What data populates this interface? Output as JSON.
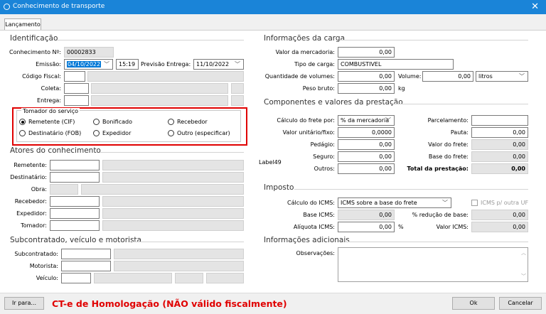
{
  "window": {
    "title": "Conhecimento de transporte",
    "close": "✕"
  },
  "tabs": [
    "Lançamento"
  ],
  "identificacao": {
    "title": "Identificação",
    "numero_label": "Conhecimento Nº:",
    "numero": "00002833",
    "emissao_label": "Emissão:",
    "emissao_date": "04/10/2022",
    "emissao_time": "15:19",
    "previsao_label": "Previsão Entrega:",
    "previsao_date": "11/10/2022",
    "codigo_fiscal_label": "Código Fiscal:",
    "coleta_label": "Coleta:",
    "entrega_label": "Entrega:"
  },
  "tomador": {
    "title": "Tomador do serviço",
    "options": [
      "Remetente (CIF)",
      "Bonificado",
      "Recebedor",
      "Destinatário (FOB)",
      "Expedidor",
      "Outro (especificar)"
    ]
  },
  "atores": {
    "title": "Atores do conhecimento",
    "remetente": "Remetente:",
    "destinatario": "Destinatário:",
    "obra": "Obra:",
    "recebedor": "Recebedor:",
    "expedidor": "Expedidor:",
    "tomador": "Tomador:"
  },
  "subcontratado": {
    "title": "Subcontratado, veículo e motorista",
    "subcontratado": "Subcontratado:",
    "motorista": "Motorista:",
    "veiculo": "Veículo:"
  },
  "carga": {
    "title": "Informações da carga",
    "valor_label": "Valor da mercadoria:",
    "valor": "0,00",
    "tipo_label": "Tipo de carga:",
    "tipo": "COMBUSTIVEL",
    "qtd_label": "Quantidade de volumes:",
    "qtd": "0,00",
    "volume_label": "Volume:",
    "volume": "0,00",
    "unidade": "litros",
    "peso_label": "Peso bruto:",
    "peso": "0,00",
    "peso_unit": "kg"
  },
  "componentes": {
    "title": "Componentes e valores da prestação",
    "calculo_label": "Cálculo do frete por:",
    "calculo": "% da mercadoria",
    "unitario_label": "Valor unitário/fixo:",
    "unitario": "0,0000",
    "pedagio_label": "Pedágio:",
    "pedagio": "0,00",
    "seguro_label": "Seguro:",
    "seguro": "0,00",
    "outros_label": "Outros:",
    "outros": "0,00",
    "label49": "Label49",
    "parcelamento_label": "Parcelamento:",
    "pauta_label": "Pauta:",
    "pauta": "0,00",
    "valor_frete_label": "Valor do frete:",
    "valor_frete": "0,00",
    "base_frete_label": "Base do frete:",
    "base_frete": "0,00",
    "total_label": "Total da prestação:",
    "total": "0,00"
  },
  "imposto": {
    "title": "Imposto",
    "calculo_label": "Cálculo do ICMS:",
    "calculo": "ICMS sobre a base do frete",
    "outra_uf": "ICMS p/ outra UF",
    "base_label": "Base ICMS:",
    "base": "0,00",
    "reducao_label": "% redução de base:",
    "reducao": "0,00",
    "aliquota_label": "Alíquota ICMS:",
    "aliquota": "0,00",
    "pct": "%",
    "valor_label": "Valor ICMS:",
    "valor": "0,00"
  },
  "adicionais": {
    "title": "Informações adicionais",
    "obs_label": "Observações:"
  },
  "footer": {
    "ir_para": "Ir para...",
    "homologacao": "CT-e de Homologação (NÃO válido fiscalmente)",
    "ok": "Ok",
    "cancelar": "Cancelar"
  }
}
